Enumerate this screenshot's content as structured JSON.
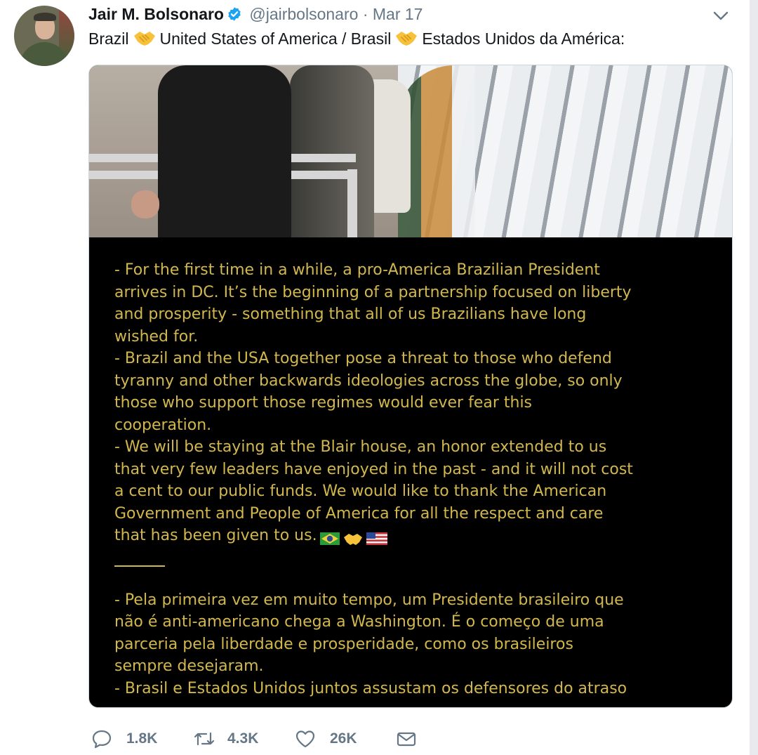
{
  "tweet": {
    "author_name": "Jair M. Bolsonaro",
    "handle": "@jairbolsonaro",
    "separator": "·",
    "date": "Mar 17",
    "text_part1": "Brazil",
    "text_part2": "United States of America / Brasil",
    "text_part3": "Estados Unidos da América:"
  },
  "media": {
    "overlay_lines_en": [
      "- For the first time in a while, a pro-America Brazilian President",
      "arrives in DC. It’s the beginning of a partnership focused on liberty",
      "and prosperity - something that all of us Brazilians have long",
      "wished for.",
      "- Brazil and the USA together pose a threat to those who defend",
      "tyranny and other backwards ideologies across the globe, so only",
      "those who support those regimes would ever fear this",
      "cooperation.",
      "- We will be staying at the Blair house, an honor extended to us",
      "that very few leaders have enjoyed in the past - and it will not cost",
      "a cent to our public funds. We would like to thank the American",
      "Government and People of America for all the respect and care",
      "that has been given to us."
    ],
    "overlay_lines_pt": [
      "- Pela primeira vez em muito tempo, um Presidente brasileiro que",
      "não é anti-americano chega a Washington. É o começo de uma",
      "parceria pela liberdade e prosperidade, como os brasileiros",
      "sempre desejaram.",
      "- Brasil e Estados Unidos juntos assustam os defensores do atraso"
    ]
  },
  "actions": {
    "replies": "1.8K",
    "retweets": "4.3K",
    "likes": "26K"
  },
  "icons": {
    "verified": "verified-badge-icon",
    "menu": "chevron-down-icon",
    "reply": "reply-icon",
    "retweet": "retweet-icon",
    "like": "heart-icon",
    "dm": "envelope-icon",
    "handshake": "handshake-emoji"
  },
  "colors": {
    "verified_blue": "#1da1f2",
    "overlay_text": "#d2b74e",
    "muted": "#657786"
  }
}
